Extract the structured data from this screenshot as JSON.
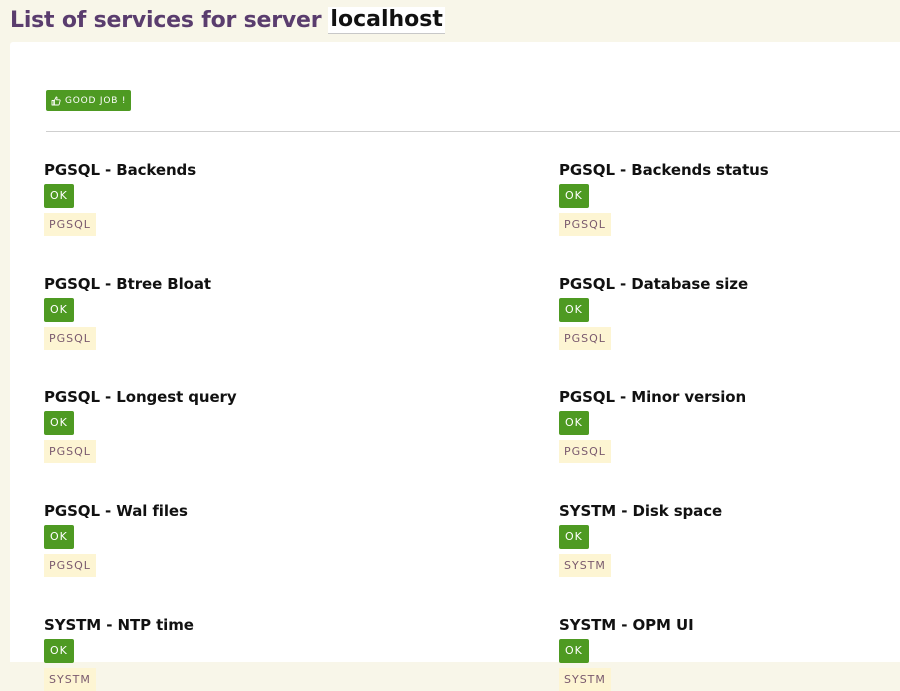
{
  "header": {
    "title": "List of services for server",
    "server": "localhost"
  },
  "good_job_button": {
    "label": "GOOD JOB !",
    "icon": "thumbs-up-icon"
  },
  "services": [
    {
      "name": "PGSQL - Backends",
      "status": "OK",
      "tag": "PGSQL"
    },
    {
      "name": "PGSQL - Backends status",
      "status": "OK",
      "tag": "PGSQL"
    },
    {
      "name": "PGSQL - Btree Bloat",
      "status": "OK",
      "tag": "PGSQL"
    },
    {
      "name": "PGSQL - Database size",
      "status": "OK",
      "tag": "PGSQL"
    },
    {
      "name": "PGSQL - Longest query",
      "status": "OK",
      "tag": "PGSQL"
    },
    {
      "name": "PGSQL - Minor version",
      "status": "OK",
      "tag": "PGSQL"
    },
    {
      "name": "PGSQL - Wal files",
      "status": "OK",
      "tag": "PGSQL"
    },
    {
      "name": "SYSTM - Disk space",
      "status": "OK",
      "tag": "SYSTM"
    },
    {
      "name": "SYSTM - NTP time",
      "status": "OK",
      "tag": "SYSTM"
    },
    {
      "name": "SYSTM - OPM UI",
      "status": "OK",
      "tag": "SYSTM"
    }
  ],
  "colors": {
    "ok_green": "#4e9a22",
    "title_purple": "#5a3d6e",
    "tag_background": "#fdf5d3",
    "page_background": "#f8f6e9"
  }
}
